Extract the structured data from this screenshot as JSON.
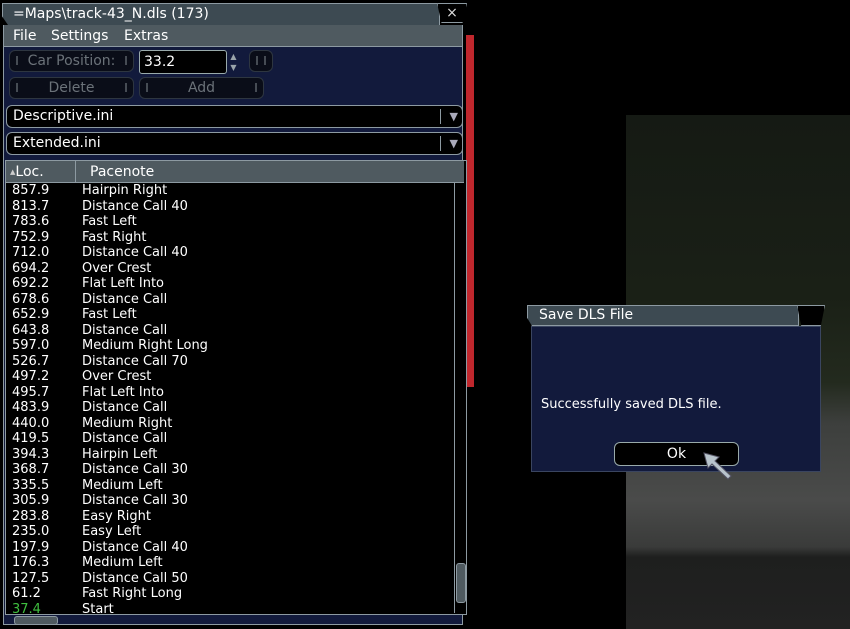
{
  "window": {
    "title": "=Maps\\track-43_N.dls (173)",
    "close_glyph": "×"
  },
  "menu": [
    "File",
    "Settings",
    "Extras"
  ],
  "toolbar": {
    "car_position_label": "Car Position:",
    "car_position_value": "33.2",
    "delete_label": "Delete",
    "add_label": "Add"
  },
  "combos": {
    "descriptive": "Descriptive.ini",
    "extended": "Extended.ini"
  },
  "list": {
    "columns": [
      "Loc.",
      "Pacenote"
    ],
    "rows": [
      [
        "857.9",
        "Hairpin Right"
      ],
      [
        "813.7",
        "Distance Call 40"
      ],
      [
        "783.6",
        "Fast Left"
      ],
      [
        "752.9",
        "Fast Right"
      ],
      [
        "712.0",
        "Distance Call 40"
      ],
      [
        "694.2",
        "Over Crest"
      ],
      [
        "692.2",
        "Flat Left Into"
      ],
      [
        "678.6",
        "Distance Call"
      ],
      [
        "652.9",
        "Fast Left"
      ],
      [
        "643.8",
        "Distance Call"
      ],
      [
        "597.0",
        "Medium Right Long"
      ],
      [
        "526.7",
        "Distance Call 70"
      ],
      [
        "497.2",
        "Over Crest"
      ],
      [
        "495.7",
        "Flat Left Into"
      ],
      [
        "483.9",
        "Distance Call"
      ],
      [
        "440.0",
        "Medium Right"
      ],
      [
        "419.5",
        "Distance Call"
      ],
      [
        "394.3",
        "Hairpin Left"
      ],
      [
        "368.7",
        "Distance Call 30"
      ],
      [
        "335.5",
        "Medium Left"
      ],
      [
        "305.9",
        "Distance Call 30"
      ],
      [
        "283.8",
        "Easy Right"
      ],
      [
        "235.0",
        "Easy Left"
      ],
      [
        "197.9",
        "Distance Call 40"
      ],
      [
        "176.3",
        "Medium Left"
      ],
      [
        "127.5",
        "Distance Call 50"
      ],
      [
        "61.2",
        "Fast Right Long"
      ],
      [
        "37.4",
        "Start"
      ]
    ],
    "highlight_color": "#3fbf3f"
  },
  "dialog": {
    "title": "Save DLS File",
    "message": "Successfully saved DLS file.",
    "ok_label": "Ok"
  },
  "colors": {
    "panel": "#121a3c",
    "header": "#4f5a60",
    "accent_red": "#c0272d"
  }
}
